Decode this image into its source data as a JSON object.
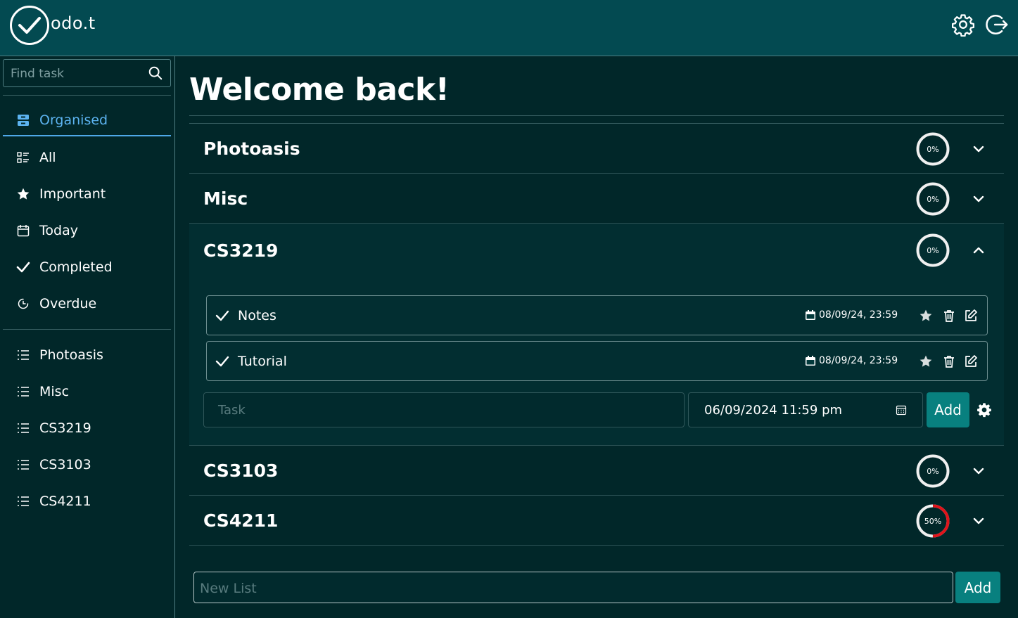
{
  "app": {
    "logo_text": "odo.t"
  },
  "header": {
    "settings_icon": "gear-icon",
    "logout_icon": "logout-icon"
  },
  "sidebar": {
    "search_placeholder": "Find task",
    "views": [
      {
        "label": "Organised",
        "icon": "organised-icon",
        "active": true
      },
      {
        "label": "All",
        "icon": "list-details-icon"
      },
      {
        "label": "Important",
        "icon": "star-icon"
      },
      {
        "label": "Today",
        "icon": "calendar-icon"
      },
      {
        "label": "Completed",
        "icon": "check-icon"
      },
      {
        "label": "Overdue",
        "icon": "clock-icon"
      }
    ],
    "lists": [
      {
        "label": "Photoasis"
      },
      {
        "label": "Misc"
      },
      {
        "label": "CS3219"
      },
      {
        "label": "CS3103"
      },
      {
        "label": "CS4211"
      }
    ]
  },
  "main": {
    "title": "Welcome back!",
    "lists": [
      {
        "name": "Photoasis",
        "progress_label": "0%",
        "progress": 0,
        "expanded": false
      },
      {
        "name": "Misc",
        "progress_label": "0%",
        "progress": 0,
        "expanded": false
      },
      {
        "name": "CS3219",
        "progress_label": "0%",
        "progress": 0,
        "expanded": true
      },
      {
        "name": "CS3103",
        "progress_label": "0%",
        "progress": 0,
        "expanded": false
      },
      {
        "name": "CS4211",
        "progress_label": "50%",
        "progress": 0.5,
        "expanded": false
      }
    ],
    "tasks": [
      {
        "name": "Notes",
        "due": "08/09/24, 23:59"
      },
      {
        "name": "Tutorial",
        "due": "08/09/24, 23:59"
      }
    ],
    "new_task": {
      "placeholder": "Task",
      "date_value": "06/09/2024 11:59 pm",
      "add_label": "Add"
    },
    "new_list": {
      "placeholder": "New List",
      "add_label": "Add"
    }
  },
  "colors": {
    "background": "#012729",
    "header": "#034a51",
    "accent": "#08807f",
    "active_nav": "#5cb3f0",
    "progress_fill": "#e0141b"
  }
}
